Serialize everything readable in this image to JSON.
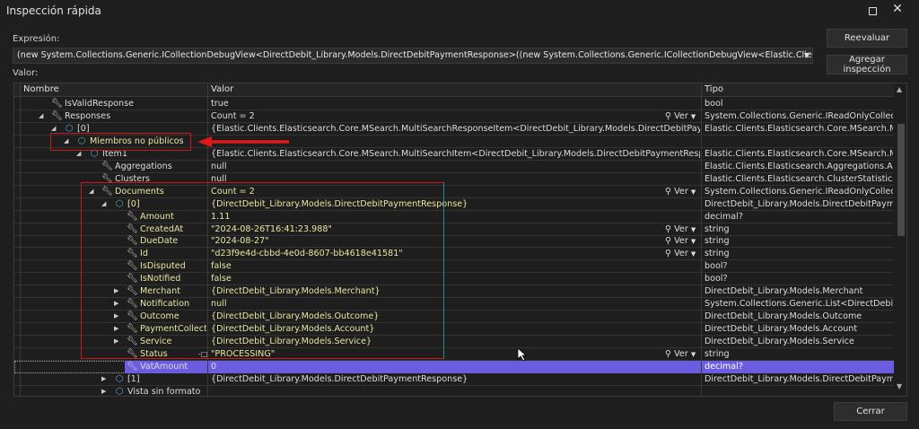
{
  "window": {
    "title": "Inspección rápida"
  },
  "expression": {
    "label": "Expresión:",
    "value": "(new System.Collections.Generic.ICollectionDebugView<DirectDebit_Library.Models.DirectDebitPaymentResponse>((new System.Collections.Generic.ICollectionDebugView<Elastic.Clients.Elasticsearch.C"
  },
  "buttons": {
    "reevaluate": "Reevaluar",
    "add_watch": "Agregar inspección",
    "close": "Cerrar"
  },
  "value_label": "Valor:",
  "columns": {
    "name": "Nombre",
    "value": "Valor",
    "type": "Tipo"
  },
  "viewer_label": "Ver",
  "rows": [
    {
      "level": 1,
      "exp": "",
      "icon": "wrench",
      "name": "IsValidResponse",
      "value": "true",
      "type": "bool",
      "hl": false,
      "viewer": false
    },
    {
      "level": 1,
      "exp": "open",
      "icon": "wrench",
      "name": "Responses",
      "value": "Count = 2",
      "type": "System.Collections.Generic.IReadOnlyCollectio...",
      "hl": false,
      "viewer": true
    },
    {
      "level": 2,
      "exp": "open",
      "icon": "object",
      "name": "[0]",
      "value": "{Elastic.Clients.Elasticsearch.Core.MSearch.MultiSearchResponseItem<DirectDebit_Library.Models.DirectDebitPaymentRespo...",
      "type": "Elastic.Clients.Elasticsearch.Core.MSearch.Mult...",
      "hl": false,
      "viewer": false
    },
    {
      "level": 3,
      "exp": "open",
      "icon": "object-green",
      "name": "Miembros no públicos",
      "value": "",
      "type": "",
      "hl": true,
      "viewer": false
    },
    {
      "level": 4,
      "exp": "open",
      "icon": "object",
      "name": "Item1",
      "value": "{Elastic.Clients.Elasticsearch.Core.MSearch.MultiSearchItem<DirectDebit_Library.Models.DirectDebitPaymentResponse>}",
      "type": "Elastic.Clients.Elasticsearch.Core.MSearch.Mult...",
      "hl": false,
      "viewer": false
    },
    {
      "level": 5,
      "exp": "",
      "icon": "wrench",
      "name": "Aggregations",
      "value": "null",
      "type": "Elastic.Clients.Elasticsearch.Aggregations.Aggr...",
      "hl": false,
      "viewer": false
    },
    {
      "level": 5,
      "exp": "",
      "icon": "wrench",
      "name": "Clusters",
      "value": "null",
      "type": "Elastic.Clients.Elasticsearch.ClusterStatistics",
      "hl": false,
      "viewer": false
    },
    {
      "level": 5,
      "exp": "open",
      "icon": "wrench",
      "name": "Documents",
      "value": "Count = 2",
      "type": "System.Collections.Generic.IReadOnlyCollectio...",
      "hl": true,
      "viewer": true
    },
    {
      "level": 6,
      "exp": "open",
      "icon": "object-green",
      "name": "[0]",
      "value": "{DirectDebit_Library.Models.DirectDebitPaymentResponse}",
      "type": "DirectDebit_Library.Models.DirectDebitPaymen...",
      "hl": true,
      "viewer": false
    },
    {
      "level": 7,
      "exp": "",
      "icon": "wrench",
      "name": "Amount",
      "value": "1.11",
      "type": "decimal?",
      "hl": true,
      "viewer": false
    },
    {
      "level": 7,
      "exp": "",
      "icon": "wrench",
      "name": "CreatedAt",
      "value": "\"2024-08-26T16:41:23.988\"",
      "type": "string",
      "hl": true,
      "viewer": true
    },
    {
      "level": 7,
      "exp": "",
      "icon": "wrench",
      "name": "DueDate",
      "value": "\"2024-08-27\"",
      "type": "string",
      "hl": true,
      "viewer": true
    },
    {
      "level": 7,
      "exp": "",
      "icon": "wrench",
      "name": "Id",
      "value": "\"d23f9e4d-cbbd-4e0d-8607-bb4618e41581\"",
      "type": "string",
      "hl": true,
      "viewer": true
    },
    {
      "level": 7,
      "exp": "",
      "icon": "wrench",
      "name": "IsDisputed",
      "value": "false",
      "type": "bool?",
      "hl": true,
      "viewer": false
    },
    {
      "level": 7,
      "exp": "",
      "icon": "wrench",
      "name": "IsNotified",
      "value": "false",
      "type": "bool?",
      "hl": true,
      "viewer": false
    },
    {
      "level": 7,
      "exp": "closed",
      "icon": "wrench",
      "name": "Merchant",
      "value": "{DirectDebit_Library.Models.Merchant}",
      "type": "DirectDebit_Library.Models.Merchant",
      "hl": true,
      "viewer": false
    },
    {
      "level": 7,
      "exp": "closed",
      "icon": "wrench",
      "name": "Notification",
      "value": "null",
      "type": "System.Collections.Generic.List<DirectDebit_Li...",
      "hl": true,
      "viewer": false
    },
    {
      "level": 7,
      "exp": "closed",
      "icon": "wrench",
      "name": "Outcome",
      "value": "{DirectDebit_Library.Models.Outcome}",
      "type": "DirectDebit_Library.Models.Outcome",
      "hl": true,
      "viewer": false
    },
    {
      "level": 7,
      "exp": "closed",
      "icon": "wrench",
      "name": "PaymentCollecti...",
      "value": "{DirectDebit_Library.Models.Account}",
      "type": "DirectDebit_Library.Models.Account",
      "hl": true,
      "viewer": false
    },
    {
      "level": 7,
      "exp": "closed",
      "icon": "wrench",
      "name": "Service",
      "value": "{DirectDebit_Library.Models.Service}",
      "type": "DirectDebit_Library.Models.Service",
      "hl": true,
      "viewer": false
    },
    {
      "level": 7,
      "exp": "",
      "icon": "wrench",
      "name": "Status",
      "value": "\"PROCESSING\"",
      "type": "string",
      "hl": true,
      "viewer": true,
      "pin": true
    },
    {
      "level": 7,
      "exp": "",
      "icon": "wrench",
      "name": "VatAmount",
      "value": "0",
      "type": "decimal?",
      "hl": false,
      "viewer": false,
      "selected": true
    },
    {
      "level": 6,
      "exp": "closed",
      "icon": "object",
      "name": "[1]",
      "value": "{DirectDebit_Library.Models.DirectDebitPaymentResponse}",
      "type": "DirectDebit_Library.Models.DirectDebitPaymen...",
      "hl": false,
      "viewer": false
    },
    {
      "level": 6,
      "exp": "closed",
      "icon": "object",
      "name": "Vista sin formato",
      "value": "",
      "type": "",
      "hl": false,
      "viewer": false
    }
  ],
  "colors": {
    "accent_selection": "#6c5ce0",
    "annotation_red": "#d01818",
    "highlight_text": "#e9e6a0"
  }
}
